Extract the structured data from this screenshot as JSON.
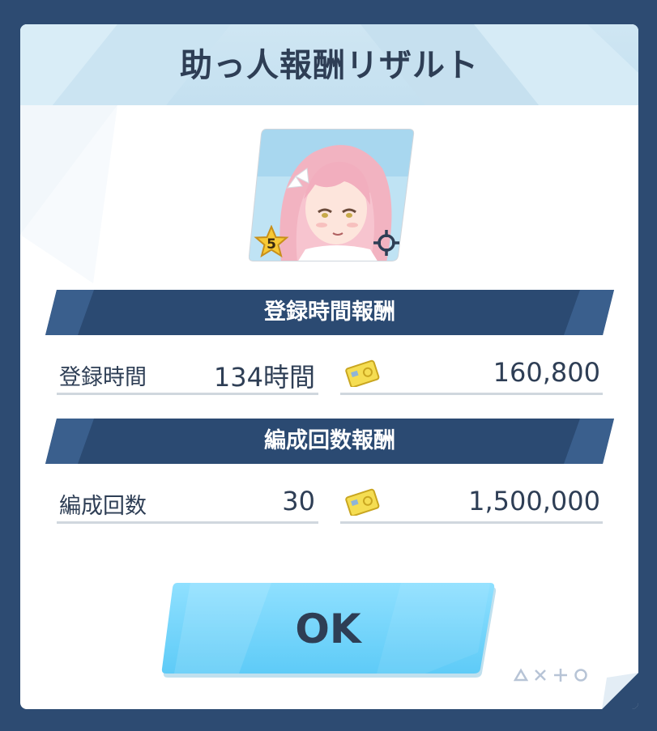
{
  "dialog": {
    "title": "助っ人報酬リザルト"
  },
  "character": {
    "star_level": "5",
    "role_icon": "crosshair-icon"
  },
  "sections": [
    {
      "title": "登録時間報酬",
      "label": "登録時間",
      "amount": "134時間",
      "reward": "160,800",
      "reward_icon": "credit-card-icon"
    },
    {
      "title": "編成回数報酬",
      "label": "編成回数",
      "amount": "30",
      "reward": "1,500,000",
      "reward_icon": "credit-card-icon"
    }
  ],
  "button": {
    "ok_label": "OK"
  },
  "colors": {
    "frame": "#2d4b72",
    "header_bg": "#c8e2f1",
    "section_bar": "#2b4a72",
    "text": "#2e3e55",
    "ok_button": "#6cd3fb"
  }
}
